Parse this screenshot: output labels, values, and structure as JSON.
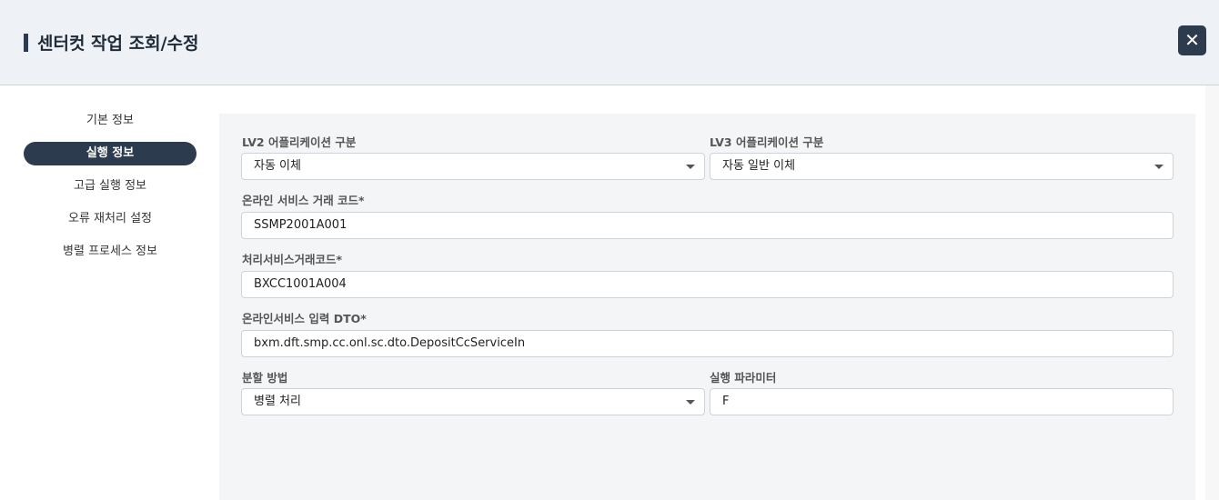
{
  "header": {
    "title": "센터컷 작업 조회/수정",
    "close_label": "✕"
  },
  "nav": {
    "items": [
      {
        "label": "기본 정보",
        "active": false
      },
      {
        "label": "실행 정보",
        "active": true
      },
      {
        "label": "고급 실행 정보",
        "active": false
      },
      {
        "label": "오류 재처리 설정",
        "active": false
      },
      {
        "label": "병렬 프로세스 정보",
        "active": false
      }
    ]
  },
  "form": {
    "lv2": {
      "label": "LV2 어플리케이션 구분",
      "value": "자동 이체"
    },
    "lv3": {
      "label": "LV3 어플리케이션 구분",
      "value": "자동 일반 이체"
    },
    "online_code": {
      "label": "온라인 서비스 거래 코드*",
      "value": "SSMP2001A001"
    },
    "process_code": {
      "label": "처리서비스거래코드*",
      "value": "BXCC1001A004"
    },
    "input_dto": {
      "label": "온라인서비스 입력 DTO*",
      "value": "bxm.dft.smp.cc.onl.sc.dto.DepositCcServiceIn"
    },
    "split": {
      "label": "분할 방법",
      "value": "병렬 처리"
    },
    "param": {
      "label": "실행 파라미터",
      "value": "F"
    }
  }
}
